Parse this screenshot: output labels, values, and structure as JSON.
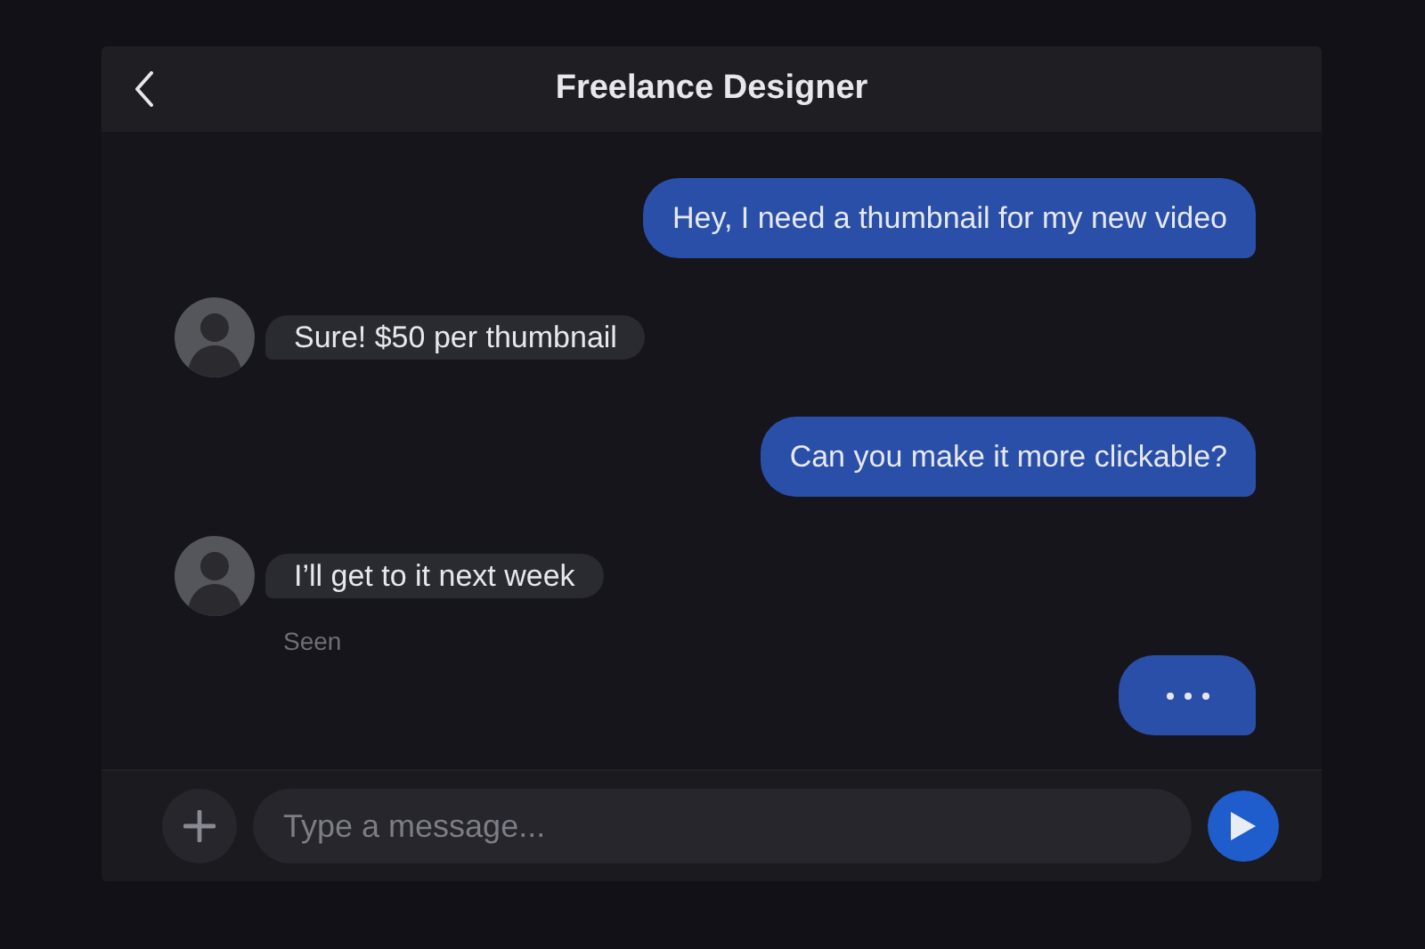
{
  "header": {
    "title": "Freelance Designer"
  },
  "messages": [
    {
      "outgoing": true,
      "kind": "text",
      "text": "Hey, I need a thumbnail for my new video"
    },
    {
      "outgoing": false,
      "kind": "text",
      "text": "Sure! $50 per thumbnail"
    },
    {
      "outgoing": true,
      "kind": "text",
      "text": "Can you make it more clickable?"
    },
    {
      "outgoing": false,
      "kind": "text",
      "text": "I’ll get to it next week",
      "receipt": "Seen"
    },
    {
      "outgoing": true,
      "kind": "typing"
    }
  ],
  "composer": {
    "placeholder": "Type a message..."
  }
}
